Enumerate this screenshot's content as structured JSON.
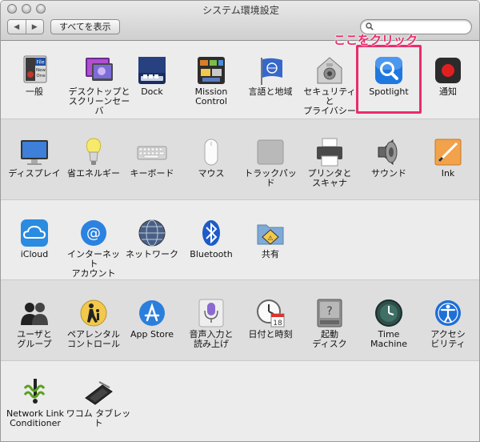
{
  "window": {
    "title": "システム環境設定"
  },
  "toolbar": {
    "show_all": "すべてを表示",
    "back": "◀",
    "forward": "▶",
    "search_value": ""
  },
  "annotation": {
    "text": "ここをクリック",
    "color": "#ea2c6d"
  },
  "sections": [
    {
      "items": [
        {
          "label": "一般",
          "icon": "general-icon"
        },
        {
          "label": "デスクトップと\nスクリーンセーバ",
          "icon": "desktop-screensaver-icon"
        },
        {
          "label": "Dock",
          "icon": "dock-icon"
        },
        {
          "label": "Mission\nControl",
          "icon": "mission-control-icon"
        },
        {
          "label": "言語と地域",
          "icon": "language-region-icon"
        },
        {
          "label": "セキュリティと\nプライバシー",
          "icon": "security-privacy-icon"
        },
        {
          "label": "Spotlight",
          "icon": "spotlight-icon"
        },
        {
          "label": "通知",
          "icon": "notifications-icon"
        }
      ]
    },
    {
      "items": [
        {
          "label": "ディスプレイ",
          "icon": "displays-icon"
        },
        {
          "label": "省エネルギー",
          "icon": "energy-saver-icon"
        },
        {
          "label": "キーボード",
          "icon": "keyboard-icon"
        },
        {
          "label": "マウス",
          "icon": "mouse-icon"
        },
        {
          "label": "トラックパッド",
          "icon": "trackpad-icon"
        },
        {
          "label": "プリンタと\nスキャナ",
          "icon": "printers-scanners-icon"
        },
        {
          "label": "サウンド",
          "icon": "sound-icon"
        },
        {
          "label": "Ink",
          "icon": "ink-icon"
        }
      ]
    },
    {
      "items": [
        {
          "label": "iCloud",
          "icon": "icloud-icon"
        },
        {
          "label": "インターネット\nアカウント",
          "icon": "internet-accounts-icon"
        },
        {
          "label": "ネットワーク",
          "icon": "network-icon"
        },
        {
          "label": "Bluetooth",
          "icon": "bluetooth-icon"
        },
        {
          "label": "共有",
          "icon": "sharing-icon"
        }
      ]
    },
    {
      "items": [
        {
          "label": "ユーザと\nグループ",
          "icon": "users-groups-icon"
        },
        {
          "label": "ペアレンタル\nコントロール",
          "icon": "parental-controls-icon"
        },
        {
          "label": "App Store",
          "icon": "app-store-icon"
        },
        {
          "label": "音声入力と\n読み上げ",
          "icon": "dictation-speech-icon"
        },
        {
          "label": "日付と時刻",
          "icon": "date-time-icon"
        },
        {
          "label": "起動\nディスク",
          "icon": "startup-disk-icon"
        },
        {
          "label": "Time\nMachine",
          "icon": "time-machine-icon"
        },
        {
          "label": "アクセシ\nビリティ",
          "icon": "accessibility-icon"
        }
      ]
    },
    {
      "items": [
        {
          "label": "Network Link\nConditioner",
          "icon": "network-link-conditioner-icon"
        },
        {
          "label": "ワコム タブレット",
          "icon": "wacom-tablet-icon"
        }
      ]
    }
  ],
  "colors": {
    "highlight": "#ea2c6d",
    "spotlight_blue": "#1f78e0"
  },
  "icon_text": {
    "general_file": "File",
    "general_new": "New",
    "general_one": "One",
    "date_day": "18"
  }
}
